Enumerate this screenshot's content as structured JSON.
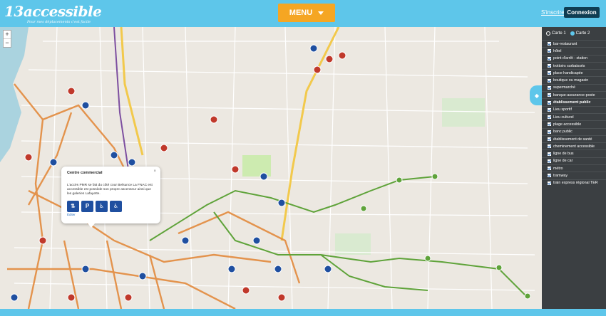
{
  "header": {
    "logo_text": "13accessible",
    "logo_tagline": "Pour mes déplacements c'est facile",
    "menu_label": "MENU",
    "signin_label": "S'inscrire",
    "connect_label": "Connexion"
  },
  "map": {
    "zoom_in": "+",
    "zoom_out": "−"
  },
  "sidebar": {
    "tabs": [
      {
        "label": "Carte 1",
        "selected": false
      },
      {
        "label": "Carte 2",
        "selected": true
      }
    ],
    "categories": [
      {
        "label": "bar-restaurant",
        "checked": true
      },
      {
        "label": "hôtel",
        "checked": true
      },
      {
        "label": "point d'arrêt - station",
        "checked": true
      },
      {
        "label": "trottoirs surbaissés",
        "checked": true
      },
      {
        "label": "place handicapée",
        "checked": true
      },
      {
        "label": "boutique ou magasin",
        "checked": true
      },
      {
        "label": "supermarché",
        "checked": true
      },
      {
        "label": "banque-assurance-poste",
        "checked": true
      },
      {
        "label": "établissement public",
        "checked": true,
        "bold": true
      },
      {
        "label": "Lieu sportif",
        "checked": true
      },
      {
        "label": "Lieu culturel",
        "checked": true
      },
      {
        "label": "plage accessible",
        "checked": true
      },
      {
        "label": "banc public",
        "checked": true
      },
      {
        "label": "établissement de santé",
        "checked": true
      },
      {
        "label": "cheminement accessible",
        "checked": true
      },
      {
        "label": "ligne de bus",
        "checked": true
      },
      {
        "label": "ligne de car",
        "checked": true
      },
      {
        "label": "métro",
        "checked": true
      },
      {
        "label": "tramway",
        "checked": true
      },
      {
        "label": "train express régional TER",
        "checked": true
      }
    ]
  },
  "popup": {
    "title": "Centre commercial",
    "close": "×",
    "text": "L'accès PMR se fait du côté cour Belsunce La FNAC est accessible est possède son propre ascenseur ainsi que les galeries Lafayette.",
    "icons": [
      "elevator-icon",
      "parking-icon",
      "wheelchair-icon",
      "wheelchair-access-icon"
    ],
    "icon_glyphs": [
      "⇅",
      "P",
      "♿",
      "♿"
    ],
    "link": "Éditer"
  },
  "colors": {
    "header": "#5ec6ea",
    "menu": "#f5a623",
    "sidebar": "#3b3f42",
    "bus_line": "#5fa33a",
    "roads": "#e38a3d",
    "highway": "#f2c94c"
  }
}
